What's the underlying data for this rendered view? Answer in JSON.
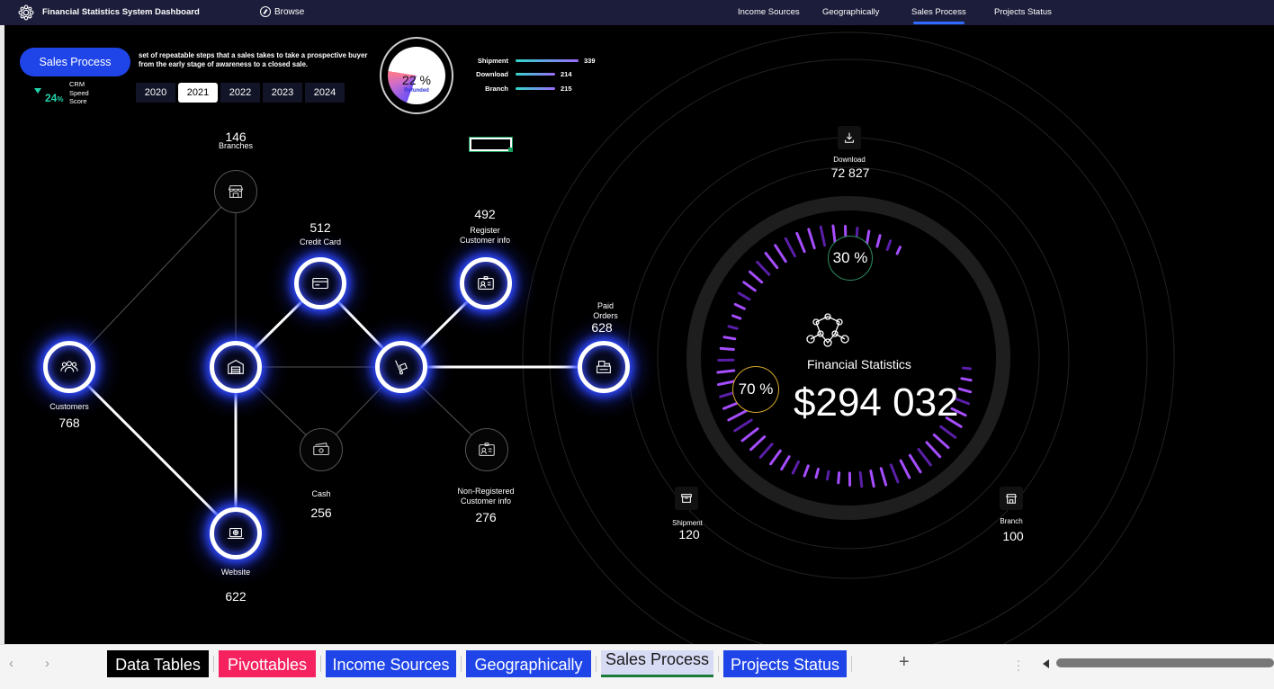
{
  "app": {
    "title": "Financial Statistics System Dashboard",
    "browse_label": "Browse"
  },
  "nav": [
    {
      "label": "Income Sources",
      "active": false
    },
    {
      "label": "Geographically",
      "active": false
    },
    {
      "label": "Sales Process",
      "active": true
    },
    {
      "label": "Projects Status",
      "active": false
    }
  ],
  "header": {
    "button_label": "Sales Process",
    "description": "set of repeatable steps that a sales takes to take a prospective buyer from the early stage of awareness to a closed sale.",
    "crm_value": "24",
    "crm_unit": "%",
    "crm_label": "CRM Speed Score",
    "years": [
      "2020",
      "2021",
      "2022",
      "2023",
      "2024"
    ],
    "selected_year": "2021"
  },
  "refunded": {
    "value": "22 %",
    "label": "Refunded",
    "fraction": 0.22
  },
  "metrics": [
    {
      "label": "Shipment",
      "value": "339"
    },
    {
      "label": "Download",
      "value": "214"
    },
    {
      "label": "Branch",
      "value": "215"
    }
  ],
  "network": {
    "branches": {
      "value": "146",
      "label": "Branches"
    },
    "credit_card": {
      "value": "512",
      "label": "Credit Card"
    },
    "register": {
      "value": "492",
      "label": "Register Customer info"
    },
    "paid_orders": {
      "value": "628",
      "label": "Paid Orders"
    },
    "customers": {
      "value": "768",
      "label": "Customers"
    },
    "cash": {
      "value": "256",
      "label": "Cash"
    },
    "non_registered": {
      "value": "276",
      "label": "Non-Registered Customer info"
    },
    "website": {
      "value": "622",
      "label": "Website"
    }
  },
  "financial": {
    "title": "Financial Statistics",
    "value": "$294 032",
    "pct_top": "30 %",
    "pct_left": "70 %",
    "download": {
      "label": "Download",
      "value": "72 827"
    },
    "shipment": {
      "label": "Shipment",
      "value": "120"
    },
    "branch": {
      "label": "Branch",
      "value": "100"
    }
  },
  "sheets": [
    {
      "label": "Data Tables",
      "color": "#000000"
    },
    {
      "label": "Pivottables",
      "color": "#f5225f"
    },
    {
      "label": "Income Sources",
      "color": "#1f45e8"
    },
    {
      "label": "Geographically",
      "color": "#1f45e8"
    },
    {
      "label": "Sales Process",
      "color": "#d8dbf4"
    },
    {
      "label": "Projects Status",
      "color": "#1f45e8"
    }
  ],
  "colors": {
    "accent": "#1f45e8",
    "topbar": "#1c1d3a",
    "teal": "#21d3a9",
    "glow": "#2f49ff",
    "purple": "#a64dff"
  }
}
